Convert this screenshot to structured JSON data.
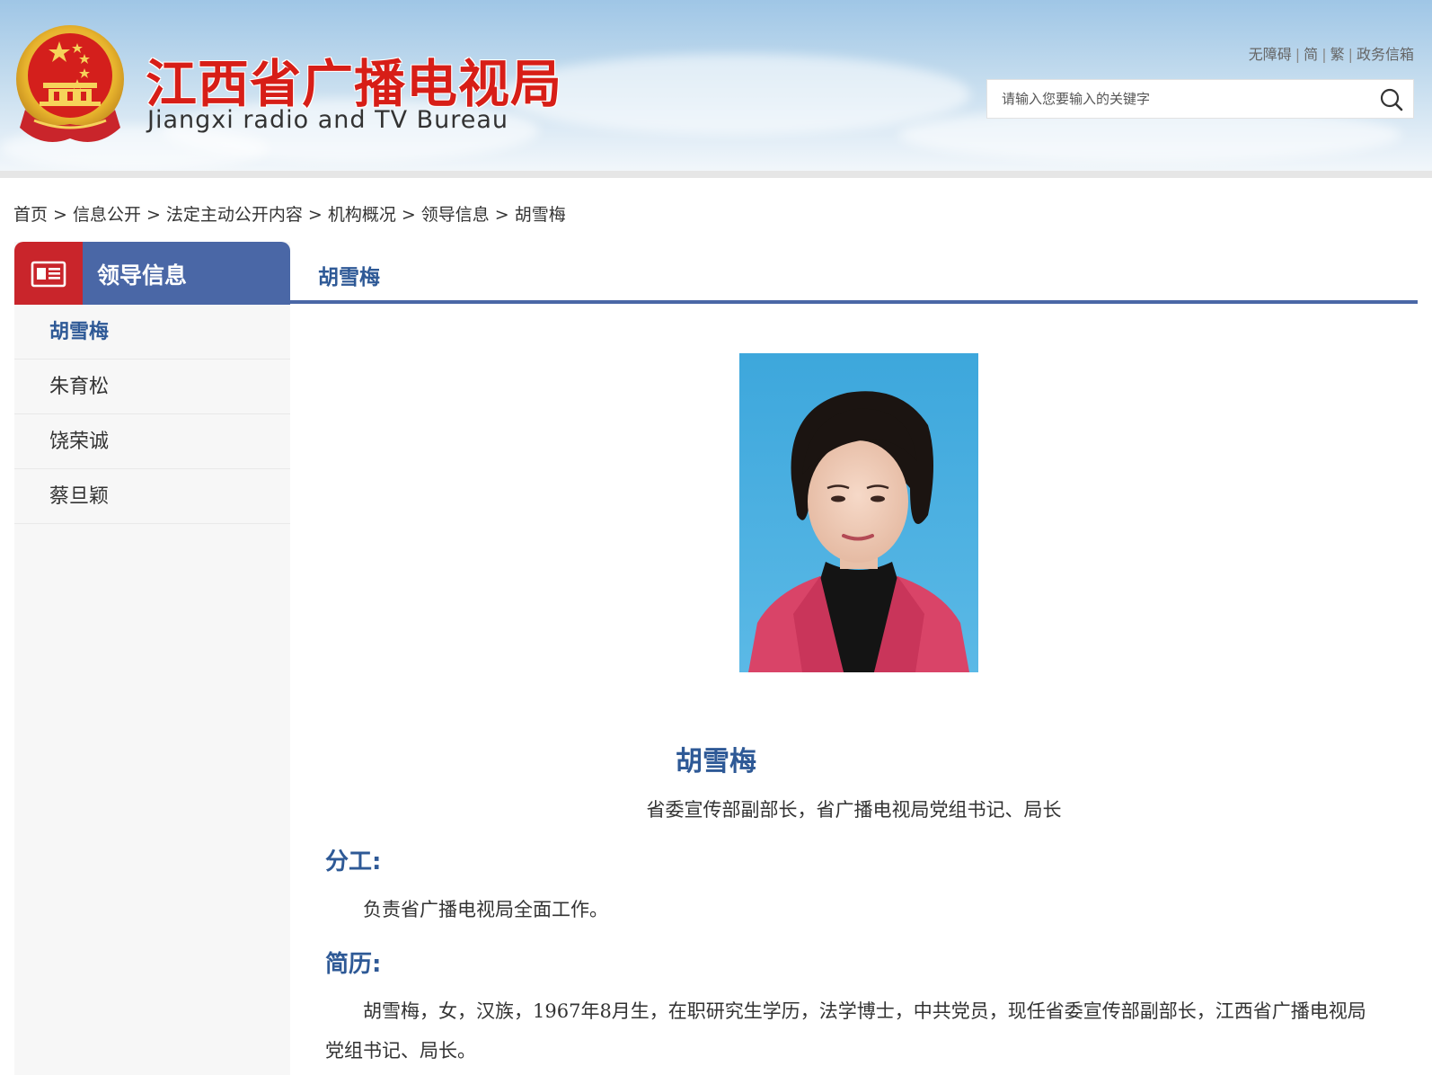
{
  "header": {
    "site_title": "江西省广播电视局",
    "site_subtitle": "Jiangxi radio and TV Bureau",
    "links": [
      "无障碍",
      "简",
      "繁",
      "政务信箱"
    ],
    "search_placeholder": "请输入您要输入的关键字"
  },
  "breadcrumb": [
    "首页",
    "信息公开",
    "法定主动公开内容",
    "机构概况",
    "领导信息",
    "胡雪梅"
  ],
  "sidebar": {
    "title": "领导信息",
    "items": [
      {
        "label": "胡雪梅",
        "active": true
      },
      {
        "label": "朱育松",
        "active": false
      },
      {
        "label": "饶荣诚",
        "active": false
      },
      {
        "label": "蔡旦颖",
        "active": false
      }
    ]
  },
  "main": {
    "tab_title": "胡雪梅",
    "name": "胡雪梅",
    "position": "省委宣传部副部长，省广播电视局党组书记、局长",
    "duties_heading": "分工:",
    "duties_text": "负责省广播电视局全面工作。",
    "resume_heading": "简历:",
    "resume_text": "胡雪梅，女，汉族，1967年8月生，在职研究生学历，法学博士，中共党员，现任省委宣传部副部长，江西省广播电视局党组书记、局长。"
  },
  "colors": {
    "brand_red": "#d71e17",
    "nav_blue": "#4a67a6",
    "accent_red": "#c9252b",
    "text_blue": "#2e5996"
  }
}
